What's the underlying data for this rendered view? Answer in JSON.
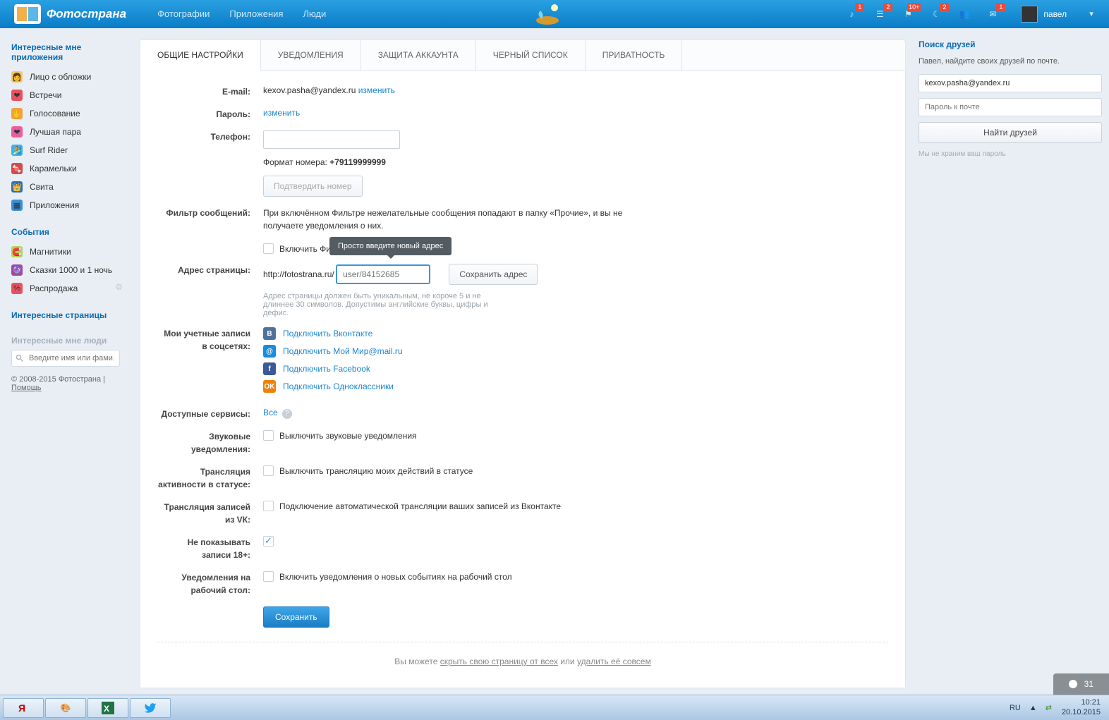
{
  "header": {
    "brand": "Фотострана",
    "nav": [
      "Фотографии",
      "Приложения",
      "Люди"
    ],
    "notif_badges": [
      "1",
      "2",
      "10+",
      "2",
      "",
      "1"
    ],
    "user": "павел"
  },
  "sidebar_left": {
    "section1": {
      "title": "Интересные мне приложения",
      "items": [
        "Лицо с обложки",
        "Встречи",
        "Голосование",
        "Лучшая пара",
        "Surf Rider",
        "Карамельки",
        "Свита",
        "Приложения"
      ]
    },
    "section2": {
      "title": "События",
      "items": [
        "Магнитики",
        "Сказки 1000 и 1 ночь",
        "Распродажа"
      ]
    },
    "pages_title": "Интересные страницы",
    "people_title": "Интересные мне люди",
    "search_placeholder": "Введите имя или фамилию",
    "footer_copy": "© 2008-2015 Фотострана | ",
    "footer_help": "Помощь"
  },
  "tabs": [
    "ОБЩИЕ НАСТРОЙКИ",
    "УВЕДОМЛЕНИЯ",
    "ЗАЩИТА АККАУНТА",
    "ЧЕРНЫЙ СПИСОК",
    "ПРИВАТНОСТЬ"
  ],
  "form": {
    "labels": {
      "email": "E-mail:",
      "password": "Пароль:",
      "phone": "Телефон:",
      "filter": "Фильтр сообщений:",
      "page_addr": "Адрес страницы:",
      "socials": "Мои учетные записи в соцсетях:",
      "services": "Доступные сервисы:",
      "sound": "Звуковые уведомления:",
      "activity": "Трансляция активности в статусе:",
      "vk": "Трансляция записей из VК:",
      "hide18": "Не показывать записи 18+:",
      "desktop": "Уведомления на рабочий стол:"
    },
    "email": "kexov.pasha@yandex.ru",
    "change": "изменить",
    "phone_format_prefix": "Формат номера: ",
    "phone_format": "+79119999999",
    "confirm_phone": "Подтвердить номер",
    "filter_desc": "При включённом Фильтре нежелательные сообщения попадают в папку «Прочие», и вы не получаете уведомления о них.",
    "filter_check": "Включить Фил",
    "tooltip": "Просто введите новый адрес",
    "url_prefix": "http://fotostrana.ru/",
    "url_placeholder": "user/84152685",
    "save_addr": "Сохранить адрес",
    "url_hint": "Адрес страницы должен быть уникальным, не короче 5 и не длиннее 30 символов. Допустимы английские буквы, цифры и дефис.",
    "social_vk": "Подключить Вконтакте",
    "social_mm": "Подключить Мой Мир@mail.ru",
    "social_fb": "Подключить Facebook",
    "social_ok": "Подключить Одноклассники",
    "services_all": "Все",
    "sound_check": "Выключить звуковые уведомления",
    "activity_check": "Выключить трансляцию моих действий в статусе",
    "vk_check": "Подключение автоматической трансляции ваших записей из Вконтакте",
    "desktop_check": "Включить уведомления о новых событиях на рабочий стол",
    "save": "Сохранить",
    "hide_prefix": "Вы можете ",
    "hide_link": "скрыть свою страницу от всех",
    "hide_mid": " или ",
    "hide_del": "удалить её совсем"
  },
  "sidebar_right": {
    "title": "Поиск друзей",
    "text": "Павел, найдите своих друзей по почте.",
    "email": "kexov.pasha@yandex.ru",
    "password_ph": "Пароль к почте",
    "find": "Найти друзей",
    "note": "Мы не храним ваш пароль"
  },
  "notif_pill": "31",
  "taskbar": {
    "lang": "RU",
    "time": "10:21",
    "date": "20.10.2015"
  }
}
